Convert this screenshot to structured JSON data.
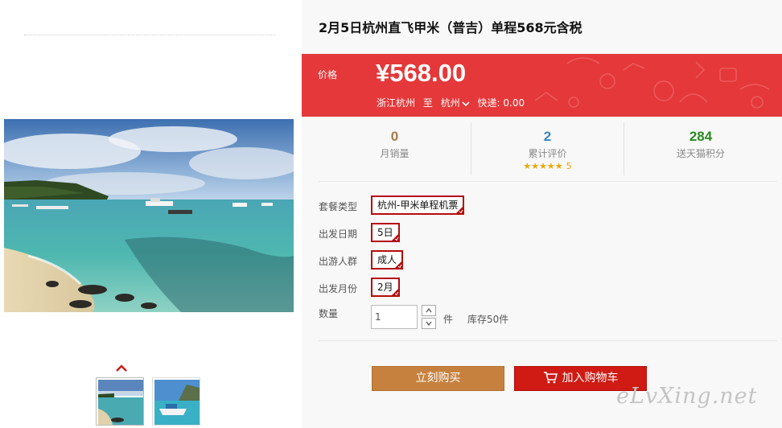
{
  "product": {
    "title": "2月5日杭州直飞甲米（普吉）单程568元含税"
  },
  "price": {
    "label": "价格",
    "value": "¥568.00",
    "origin": "浙江杭州",
    "to_label": "至",
    "destination": "杭州",
    "shipping": "快递: 0.00"
  },
  "stats": [
    {
      "value": "0",
      "label": "月销量",
      "color": "#a87848"
    },
    {
      "value": "2",
      "label": "累计评价",
      "color": "#3a84b8",
      "stars": "★★★★★",
      "score": "5"
    },
    {
      "value": "284",
      "label": "送天猫积分",
      "color": "#2a8a1e"
    }
  ],
  "options": [
    {
      "label": "套餐类型",
      "value": "杭州-甲米单程机票"
    },
    {
      "label": "出发日期",
      "value": "5日"
    },
    {
      "label": "出游人群",
      "value": "成人"
    },
    {
      "label": "出发月份",
      "value": "2月"
    }
  ],
  "quantity": {
    "label": "数量",
    "value": "1",
    "unit": "件",
    "stock": "库存50件"
  },
  "actions": {
    "buy_now": "立刻购买",
    "add_to_cart": "加入购物车"
  },
  "watermark": "eLvXing.net",
  "colors": {
    "price_band": "#e5383a",
    "buy_button": "#c7813e",
    "cart_button": "#cf1b14",
    "option_border": "#b50c0c"
  },
  "icons": {
    "thumbnail_up": "chevron-up-icon",
    "destination_dropdown": "chevron-down-icon",
    "cart": "shopping-cart-icon",
    "option_selected": "selected-check-icon"
  }
}
